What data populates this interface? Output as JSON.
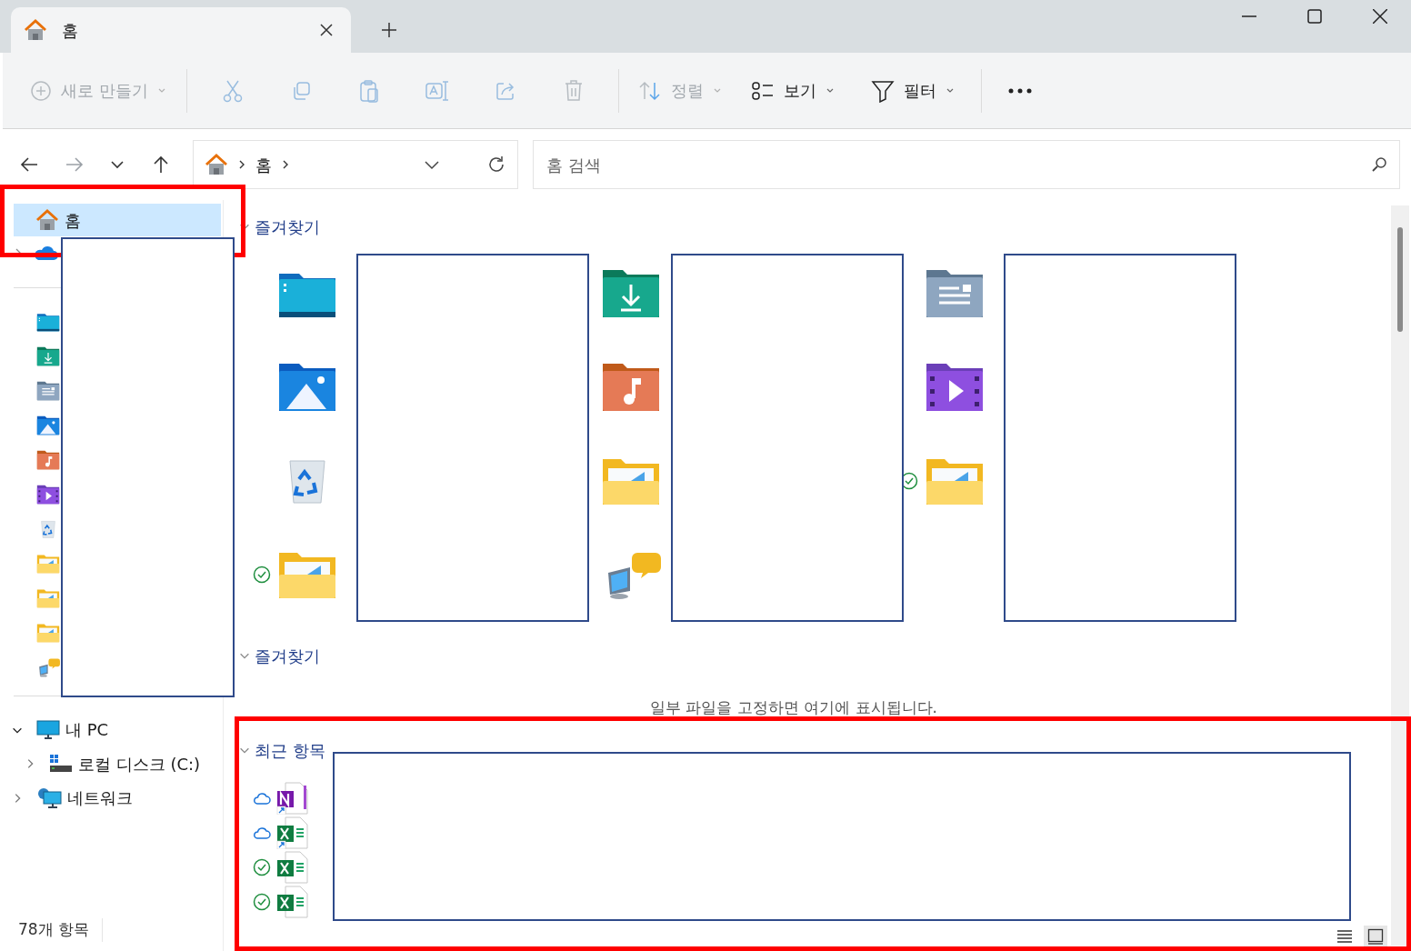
{
  "tabs": [
    {
      "label": "홈",
      "selected": true
    }
  ],
  "toolbar": [
    {
      "kind": "new",
      "label": "새로 만들기",
      "disabled": true,
      "menu": true
    },
    {
      "kind": "cut",
      "disabled": true
    },
    {
      "kind": "copy",
      "disabled": true
    },
    {
      "kind": "paste",
      "disabled": true
    },
    {
      "kind": "rename",
      "disabled": true
    },
    {
      "kind": "share",
      "disabled": true
    },
    {
      "kind": "delete",
      "disabled": true
    },
    {
      "kind": "sort",
      "label": "정렬",
      "disabled": true,
      "menu": true
    },
    {
      "kind": "view",
      "label": "보기",
      "disabled": false,
      "menu": true
    },
    {
      "kind": "filter",
      "label": "필터",
      "disabled": false,
      "menu": true
    },
    {
      "kind": "more",
      "disabled": false
    }
  ],
  "navigation": [
    {
      "kind": "back",
      "disabled": false
    },
    {
      "kind": "forward",
      "disabled": true
    },
    {
      "kind": "recent",
      "disabled": false
    },
    {
      "kind": "up",
      "disabled": false
    }
  ],
  "address": {
    "breadcrumb": [
      "홈"
    ]
  },
  "search": {
    "placeholder": "홈 검색"
  },
  "sidebar": {
    "home": {
      "label": "홈",
      "selected": true
    },
    "quick_access": [
      {
        "kind": "desktop"
      },
      {
        "kind": "downloads"
      },
      {
        "kind": "documents"
      },
      {
        "kind": "pictures"
      },
      {
        "kind": "music"
      },
      {
        "kind": "videos"
      },
      {
        "kind": "recycle"
      },
      {
        "kind": "folder"
      },
      {
        "kind": "folder"
      },
      {
        "kind": "folder"
      },
      {
        "kind": "netpc"
      }
    ],
    "tree": [
      {
        "label": "내 PC",
        "kind": "pc",
        "expanded": true,
        "children": [
          {
            "label": "로컬 디스크 (C:)",
            "kind": "disk",
            "expanded": false
          }
        ]
      },
      {
        "label": "네트워크",
        "kind": "network",
        "expanded": false
      }
    ]
  },
  "sections": [
    {
      "title": "즐겨찾기",
      "expanded": true,
      "kind": "tiles",
      "tiles": [
        {
          "kind": "desktop"
        },
        {
          "kind": "downloads"
        },
        {
          "kind": "documents"
        },
        {
          "kind": "pictures"
        },
        {
          "kind": "music"
        },
        {
          "kind": "videos"
        },
        {
          "kind": "recycle"
        },
        {
          "kind": "folder"
        },
        {
          "kind": "folder",
          "synced": true
        },
        {
          "kind": "folder",
          "synced": true
        },
        {
          "kind": "netpc"
        }
      ]
    },
    {
      "title": "즐겨찾기",
      "expanded": true,
      "kind": "empty",
      "hint": "일부 파일을 고정하면 여기에 표시됩니다."
    },
    {
      "title": "최근 항목",
      "expanded": true,
      "kind": "files",
      "files": [
        {
          "kind": "onenote",
          "synced": false,
          "shortcut": true
        },
        {
          "kind": "excel",
          "synced": false,
          "shortcut": true
        },
        {
          "kind": "excel",
          "synced": true,
          "shortcut": false
        },
        {
          "kind": "excel",
          "synced": true,
          "shortcut": false
        }
      ]
    }
  ],
  "status_bar": {
    "count": "78개 항목",
    "views": [
      {
        "kind": "details",
        "selected": false
      },
      {
        "kind": "tiles",
        "selected": true
      }
    ]
  }
}
